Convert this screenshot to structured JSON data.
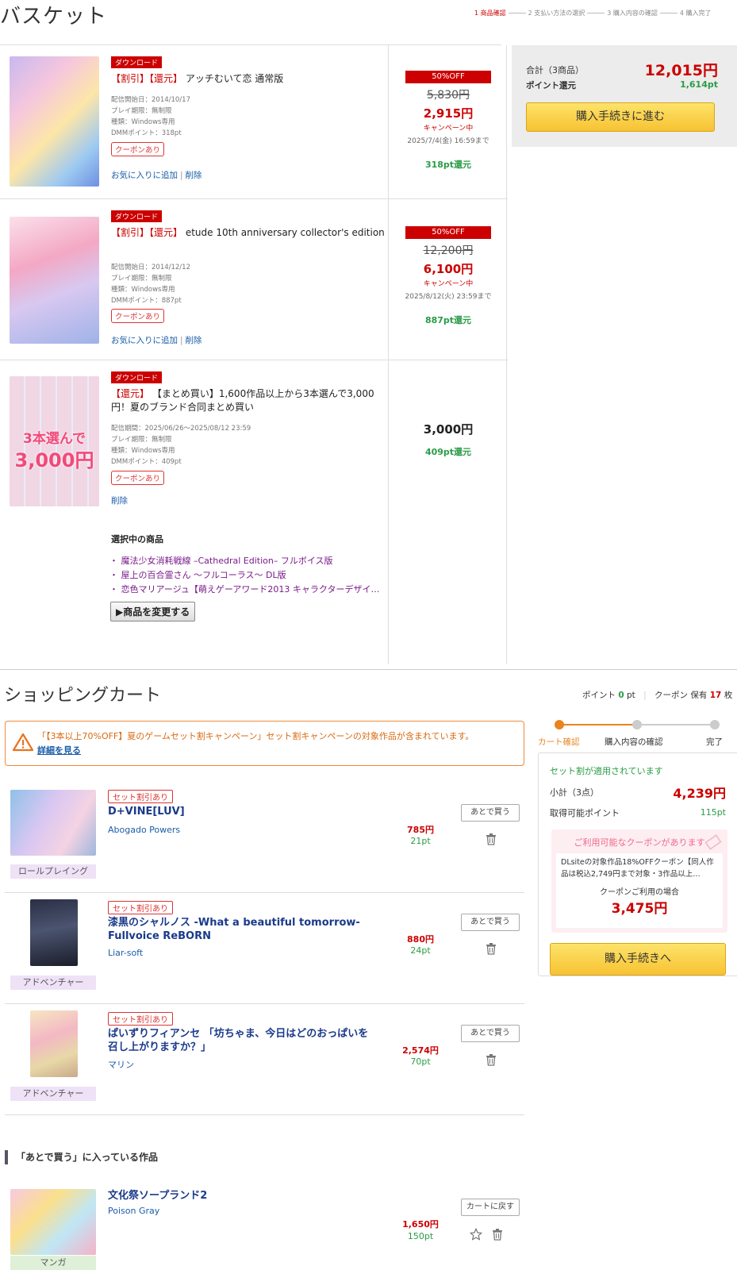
{
  "header": {
    "title": "バスケット",
    "steps": [
      "1 商品確認",
      "2 支払い方法の選択",
      "3 購入内容の確認",
      "4 購入完了"
    ]
  },
  "basket": {
    "items": [
      {
        "type_badge": "ダウンロード",
        "tags": "【割引】【還元】",
        "name": "アッチむいて恋 通常版",
        "meta": [
          "配信開始日：2014/10/17",
          "プレイ期限：無制限",
          "種類：Windows専用",
          "DMMポイント：318pt"
        ],
        "coupon": "クーポンあり",
        "fav": "お気に入りに追加",
        "del": "削除",
        "off": "50%OFF",
        "old_price": "5,830円",
        "new_price": "2,915円",
        "campaign": "キャンペーン中",
        "until": "2025/7/4(金) 16:59まで",
        "points": "318pt還元"
      },
      {
        "type_badge": "ダウンロード",
        "tags": "【割引】【還元】",
        "name": "etude 10th anniversary collector's edition",
        "meta": [
          "配信開始日：2014/12/12",
          "プレイ期限：無制限",
          "種類：Windows専用",
          "DMMポイント：887pt"
        ],
        "coupon": "クーポンあり",
        "fav": "お気に入りに追加",
        "del": "削除",
        "off": "50%OFF",
        "old_price": "12,200円",
        "new_price": "6,100円",
        "campaign": "キャンペーン中",
        "until": "2025/8/12(火) 23:59まで",
        "points": "887pt還元"
      },
      {
        "type_badge": "ダウンロード",
        "tags": "【還元】",
        "name": "【まとめ買い】1,600作品以上から3本選んで3,000円！夏のブランド合同まとめ買い",
        "meta": [
          "配信期間：2025/06/26～2025/08/12 23:59",
          "プレイ期限：無制限",
          "種類：Windows専用",
          "DMMポイント：409pt"
        ],
        "coupon": "クーポンあり",
        "del": "削除",
        "price": "3,000円",
        "points": "409pt還元",
        "thumb_text_1": "3本選んで",
        "thumb_text_2": "3,000円",
        "selected_title": "選択中の商品",
        "selected": [
          "・ 魔法少女消耗戦線 –Cathedral Edition– フルボイス版",
          "・ 屋上の百合霊さん ～フルコーラス～ DL版",
          "・ 恋色マリアージュ【萌えゲーアワード2013 キャラクターデザイ…"
        ],
        "change_btn": "▶商品を変更する"
      }
    ],
    "summary": {
      "total_label": "合計（3商品）",
      "total": "12,015円",
      "points_label": "ポイント還元",
      "points": "1,614pt",
      "button": "購入手続きに進む"
    }
  },
  "cart": {
    "title": "ショッピングカート",
    "points_label": "ポイント",
    "points_value": "0",
    "points_unit": "pt",
    "coupon_label": "クーポン 保有",
    "coupon_value": "17",
    "coupon_unit": "枚",
    "alert": "「【3本以上70%OFF】夏のゲームセット割キャンペーン」セット割キャンペーンの対象作品が含まれています。",
    "alert_link": "詳細を見る",
    "items": [
      {
        "badge": "セット割引あり",
        "name": "D+VINE[LUV]",
        "maker": "Abogado Powers",
        "genre": "ロールプレイング",
        "price": "785円",
        "points": "21pt",
        "later": "あとで買う"
      },
      {
        "badge": "セット割引あり",
        "name": "漆黒のシャルノス -What a beautiful tomorrow- Fullvoice ReBORN",
        "maker": "Liar-soft",
        "genre": "アドベンチャー",
        "price": "880円",
        "points": "24pt",
        "later": "あとで買う"
      },
      {
        "badge": "セット割引あり",
        "name": "ぱいずりフィアンセ 「坊ちゃま、今日はどのおっぱいを召し上がりますか？」",
        "maker": "マリン",
        "genre": "アドベンチャー",
        "price": "2,574円",
        "points": "70pt",
        "later": "あとで買う"
      }
    ],
    "progress": [
      "カート確認",
      "購入内容の確認",
      "完了"
    ],
    "side": {
      "applied": "セット割が適用されています",
      "subtotal_label": "小計（3点）",
      "subtotal": "4,239円",
      "points_label": "取得可能ポイント",
      "points": "115pt",
      "coupon_head": "ご利用可能なクーポンがあります",
      "coupon_desc": "DLsiteの対象作品18%OFFクーポン【同人作品は税込2,749円まで対象・3作品以上…",
      "coupon_use": "クーポンご利用の場合",
      "coupon_price": "3,475円",
      "button": "購入手続きへ"
    }
  },
  "later": {
    "head": "「あとで買う」に入っている作品",
    "items": [
      {
        "name": "文化祭ソープランド2",
        "maker": "Poison Gray",
        "genre": "マンガ",
        "price": "1,650円",
        "points": "150pt",
        "back": "カートに戻す"
      }
    ]
  },
  "colors": {
    "accent_red": "#cc0000",
    "point_green": "#2a9c46",
    "link_blue": "#1a5da8",
    "button_yellow": "#f7c232",
    "alert_orange": "#f08a3a"
  }
}
